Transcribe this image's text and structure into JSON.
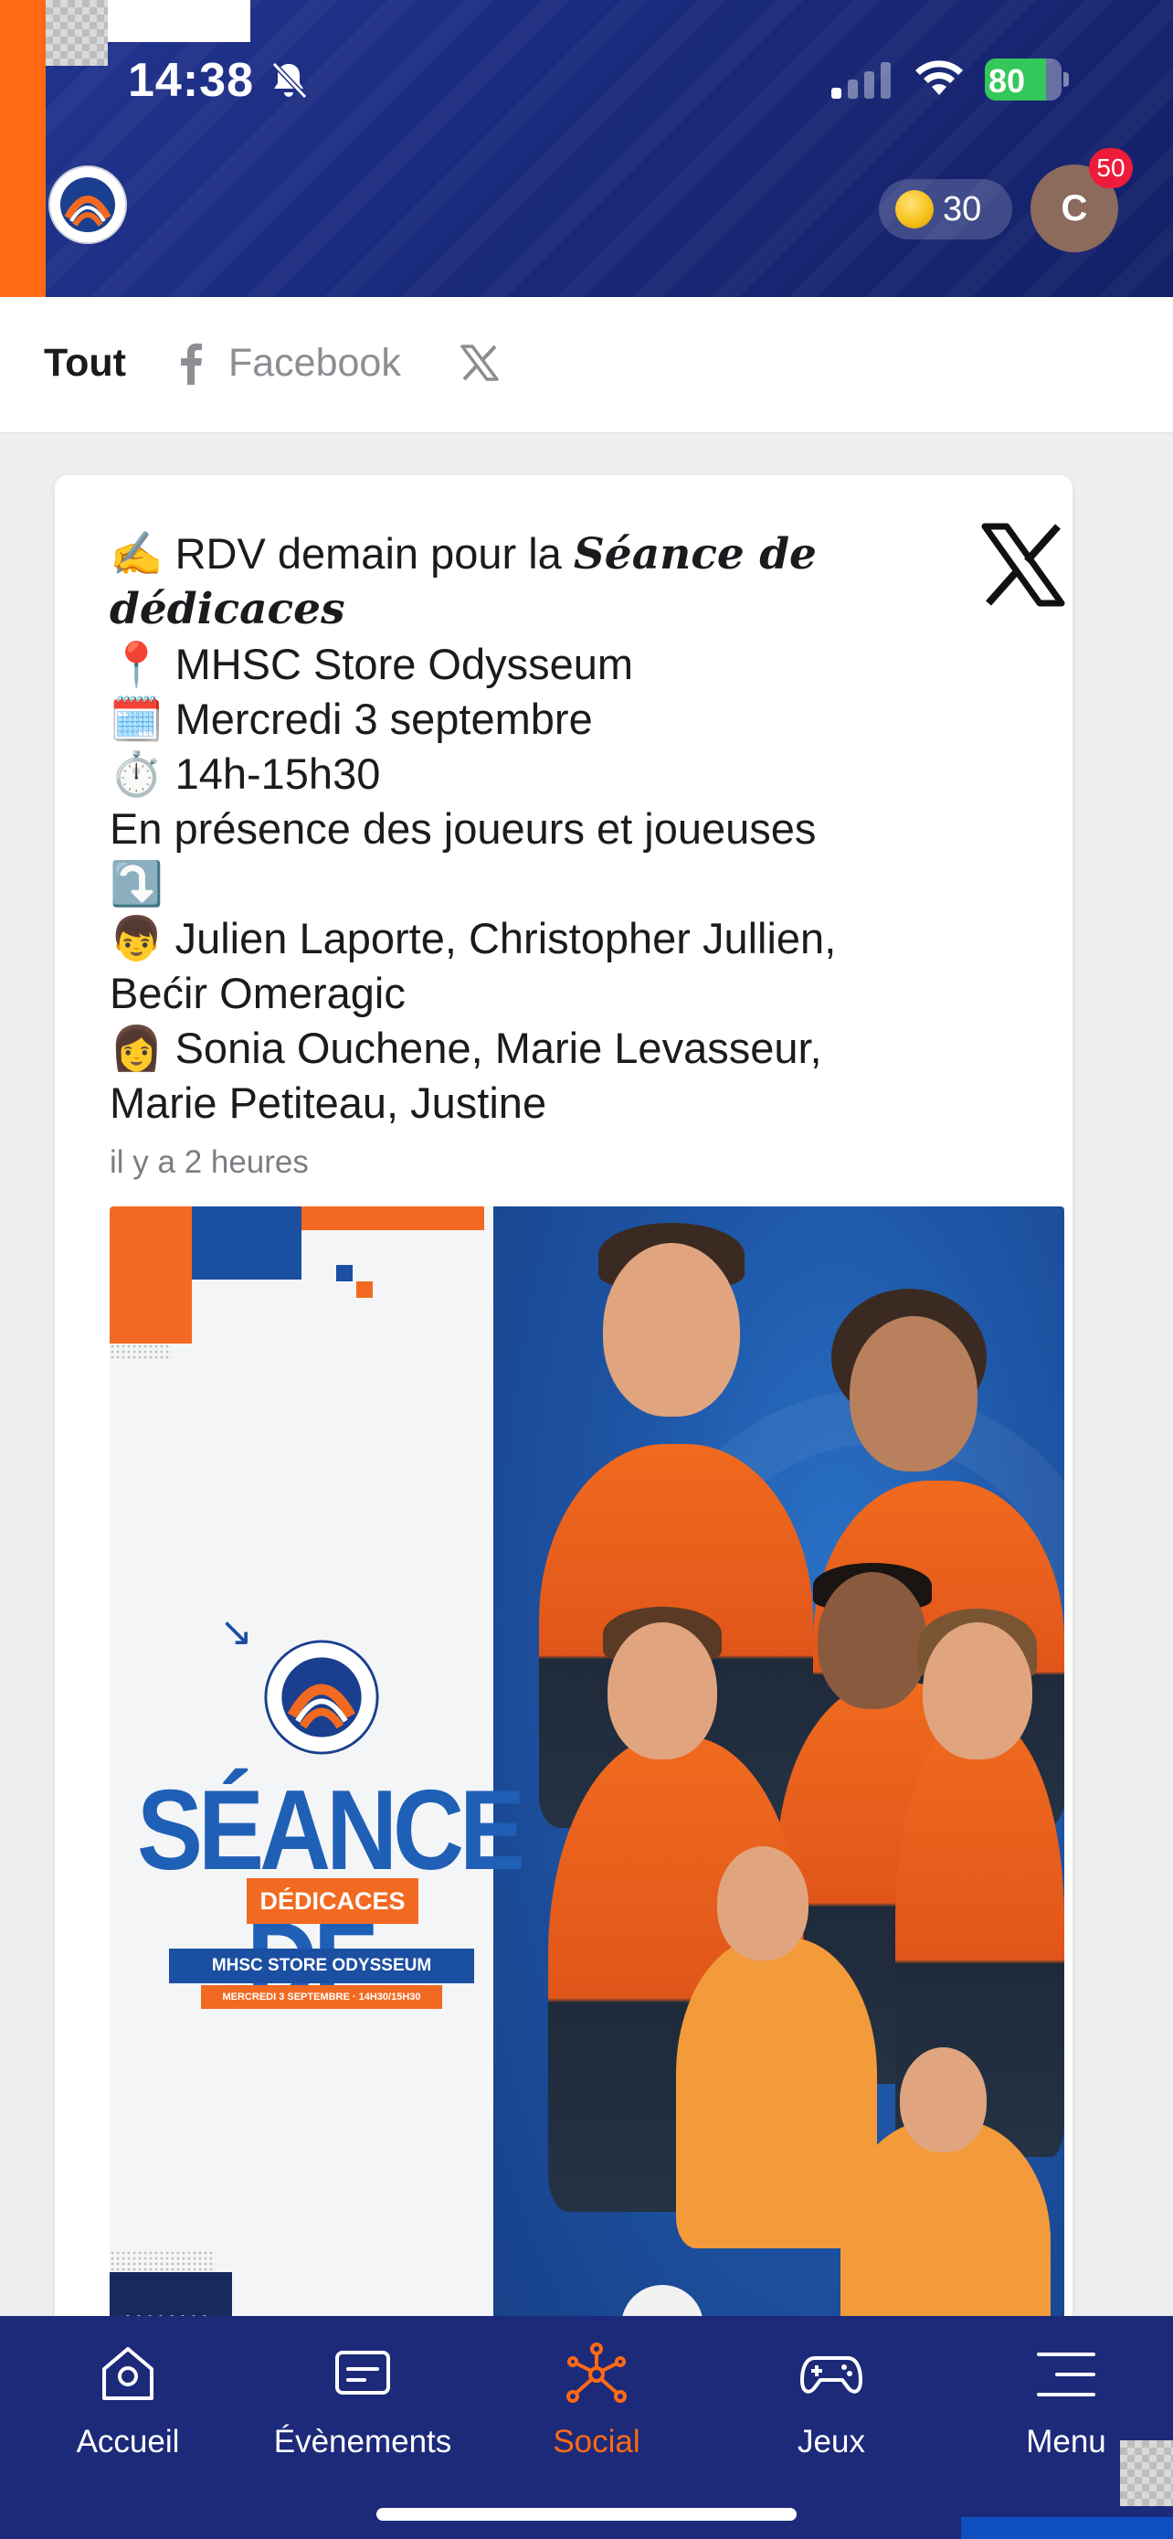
{
  "status_bar": {
    "time": "14:38",
    "battery_percent": "80",
    "battery_level": 0.8,
    "icons": [
      "bell-slash-icon",
      "cellular-signal-icon",
      "wifi-icon",
      "battery-charging-icon"
    ]
  },
  "header": {
    "club_logo": "montpellier-herault-sport-club-logo",
    "coins": "30",
    "avatar_initial": "C",
    "notification_count": "50",
    "colors": {
      "background": "#1d2a7a",
      "accent": "#ff6a13"
    }
  },
  "filters": {
    "all_label": "Tout",
    "facebook_label": "Facebook",
    "x_icon": "x-logo-icon"
  },
  "post": {
    "source_icon": "x-logo-icon",
    "line1_prefix": "✍️ RDV demain pour la ",
    "line1_emphasis": "Séance de",
    "line2_emphasis": "dédicaces",
    "line3": "📍 MHSC Store Odysseum",
    "line4": "🗓️ Mercredi 3 septembre",
    "line5": "⏱️ 14h-15h30",
    "line6": "En présence des joueurs et joueuses",
    "line7": "⤵️",
    "line8": "👦 Julien Laporte, Christopher Jullien,",
    "line9": "Bećir Omeragic",
    "line10": "👩 Sonia Ouchene, Marie Levasseur,",
    "line11": "Marie Petiteau, Justine",
    "timestamp": "il y a 2 heures",
    "poster": {
      "title": "SÉANCE DE",
      "subtitle": "DÉDICACES",
      "store": "MHSC STORE ODYSSEUM",
      "date": "MERCREDI 3 SEPTEMBRE · 14H30/15H30"
    }
  },
  "bottom_nav": {
    "items": [
      {
        "label": "Accueil",
        "icon": "home-icon"
      },
      {
        "label": "Évènements",
        "icon": "calendar-icon"
      },
      {
        "label": "Social",
        "icon": "network-icon"
      },
      {
        "label": "Jeux",
        "icon": "gamepad-icon"
      },
      {
        "label": "Menu",
        "icon": "hamburger-menu-icon"
      }
    ],
    "active": "Social"
  }
}
